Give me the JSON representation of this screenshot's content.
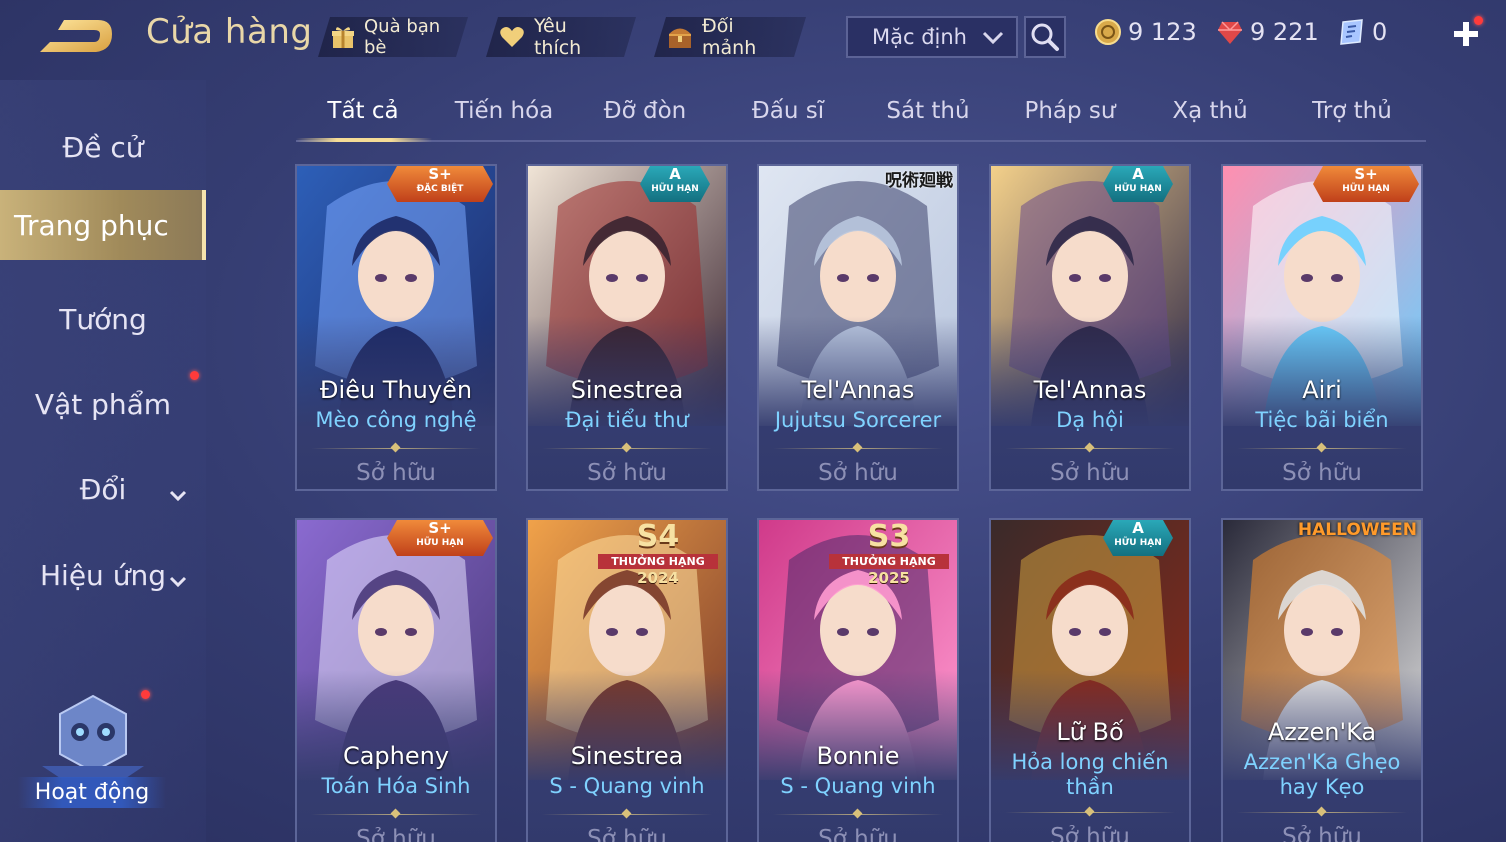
{
  "header": {
    "title": "Cửa hàng",
    "buttons": [
      {
        "label": "Quà bạn bè",
        "icon": "gift-icon"
      },
      {
        "label": "Yêu thích",
        "icon": "heart-icon"
      },
      {
        "label": "Đổi mảnh",
        "icon": "chest-icon"
      }
    ],
    "sort_value": "Mặc định",
    "currencies": [
      {
        "value": "9 123",
        "icon": "gold-coin-icon"
      },
      {
        "value": "9 221",
        "icon": "red-gem-icon"
      },
      {
        "value": "0",
        "icon": "voucher-icon"
      }
    ]
  },
  "sidebar": {
    "items": [
      {
        "label": "Đề cử"
      },
      {
        "label": "Trang phục"
      },
      {
        "label": "Tướng"
      },
      {
        "label": "Vật phẩm"
      },
      {
        "label": "Đổi"
      },
      {
        "label": "Hiệu ứng"
      }
    ],
    "activity_label": "Hoạt động"
  },
  "tabs": [
    "Tất cả",
    "Tiến hóa",
    "Đỡ đòn",
    "Đấu sĩ",
    "Sát thủ",
    "Pháp sư",
    "Xạ thủ",
    "Trợ thủ"
  ],
  "cards": [
    {
      "hero": "Điêu Thuyền",
      "skin": "Mèo công nghệ",
      "status": "Sở hữu",
      "badge_main": "S+",
      "badge_sub": "ĐẶC BIỆT"
    },
    {
      "hero": "Sinestrea",
      "skin": "Đại tiểu thư",
      "status": "Sở hữu",
      "badge_main": "A",
      "badge_sub": "HỮU HẠN"
    },
    {
      "hero": "Tel'Annas",
      "skin": "Jujutsu Sorcerer",
      "status": "Sở hữu",
      "badge_main": "呪術廻戦",
      "badge_sub": ""
    },
    {
      "hero": "Tel'Annas",
      "skin": "Dạ hội",
      "status": "Sở hữu",
      "badge_main": "A",
      "badge_sub": "HỮU HẠN"
    },
    {
      "hero": "Airi",
      "skin": "Tiệc bãi biển",
      "status": "Sở hữu",
      "badge_main": "S+",
      "badge_sub": "HỮU HẠN"
    },
    {
      "hero": "Capheny",
      "skin": "Toán Hóa Sinh",
      "status": "Sở hữu",
      "badge_main": "S+",
      "badge_sub": "HỮU HẠN"
    },
    {
      "hero": "Sinestrea",
      "skin": "S - Quang vinh",
      "status": "Sở hữu",
      "badge_main": "S4",
      "badge_sub": "THƯỞNG HẠNG",
      "badge_year": "2024"
    },
    {
      "hero": "Bonnie",
      "skin": "S - Quang vinh",
      "status": "Sở hữu",
      "badge_main": "S3",
      "badge_sub": "THƯỞNG HẠNG",
      "badge_year": "2025"
    },
    {
      "hero": "Lữ Bố",
      "skin": "Hỏa long chiến thần",
      "status": "Sở hữu",
      "badge_main": "A",
      "badge_sub": "HỮU HẠN"
    },
    {
      "hero": "Azzen'Ka",
      "skin": "Azzen'Ka Ghẹo hay Kẹo",
      "status": "Sở hữu",
      "badge_main": "HALLOWEEN",
      "badge_sub": ""
    }
  ],
  "colors": {
    "background": "#353d72",
    "accent_gold": "#e9d7a8",
    "skin_name": "#7fd2ff",
    "owned_text": "#8d90b6"
  }
}
